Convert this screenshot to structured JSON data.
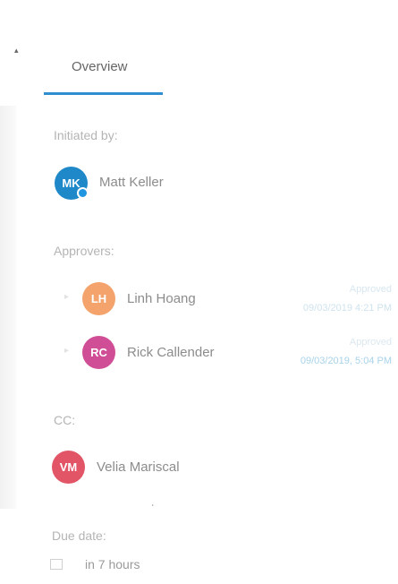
{
  "tabs": [
    {
      "label": "Overview",
      "selected": true
    },
    {
      "label": "",
      "selected": false
    },
    {
      "label": "",
      "selected": false
    }
  ],
  "initiated_by": {
    "label": "Initiated by:",
    "person": {
      "initials": "MK",
      "name": "Matt Keller",
      "color": "#1e88c9",
      "presence_color": "#2196e0"
    }
  },
  "approvers": {
    "label": "Approvers:",
    "people": [
      {
        "initials": "LH",
        "name": "Linh Hoang",
        "color": "#f3a36b",
        "status": "Approved",
        "timestamp": "09/03/2019 4:21 PM"
      },
      {
        "initials": "RC",
        "name": "Rick Callender",
        "color": "#cf4e95",
        "status": "Approved",
        "timestamp": "09/03/2019, 5:04 PM"
      }
    ]
  },
  "cc": {
    "label": "CC:",
    "person": {
      "initials": "VM",
      "name": "Velia Mariscal",
      "color": "#e25566"
    }
  },
  "due_date": {
    "label": "Due date:",
    "value": "in 7 hours"
  },
  "colors": {
    "accent": "#2f8ed0"
  }
}
